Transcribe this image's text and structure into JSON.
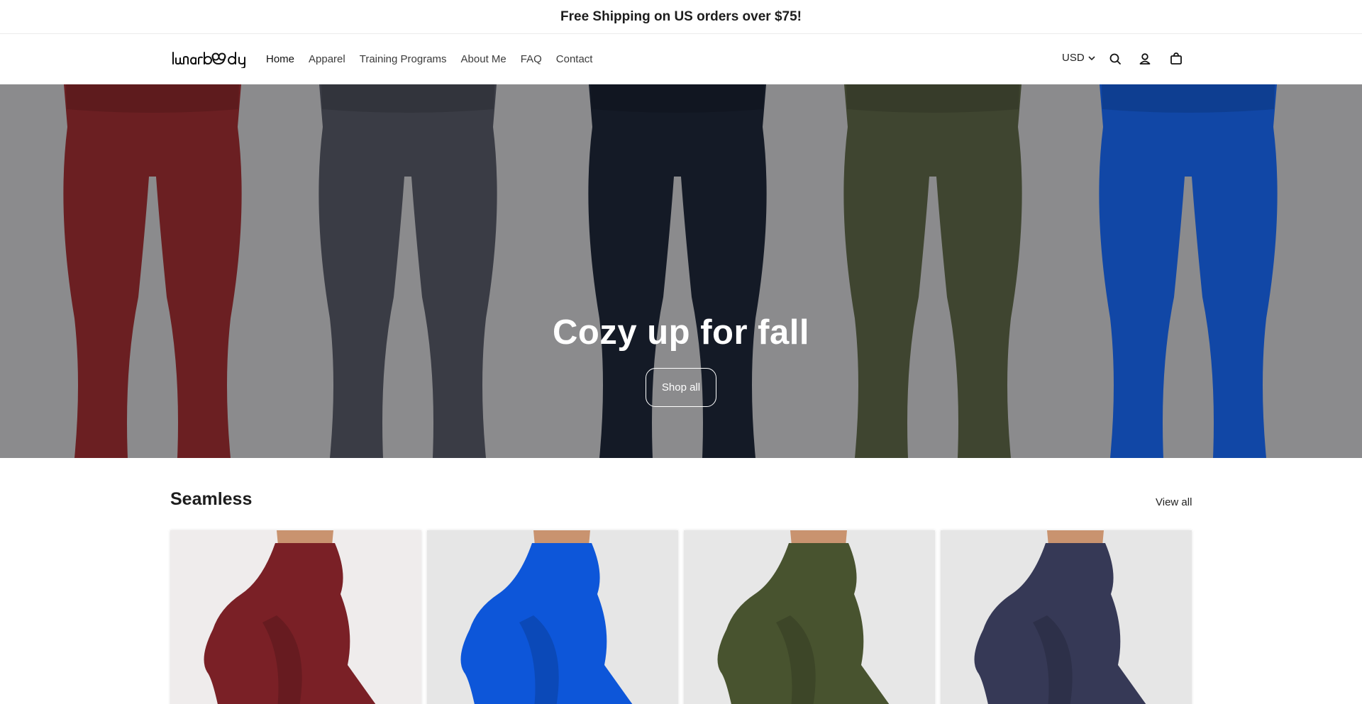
{
  "announcement": {
    "text": "Free Shipping on US orders over $75!"
  },
  "header": {
    "logo_text": "lunarbody",
    "nav": [
      {
        "label": "Home",
        "active": true
      },
      {
        "label": "Apparel"
      },
      {
        "label": "Training Programs"
      },
      {
        "label": "About Me"
      },
      {
        "label": "FAQ"
      },
      {
        "label": "Contact"
      }
    ],
    "currency": "USD",
    "icons": [
      "chevron-down-icon",
      "search-icon",
      "account-icon",
      "cart-icon"
    ]
  },
  "hero": {
    "title": "Cozy up for fall",
    "button_label": "Shop all",
    "legging_colors": [
      "#6b1f22",
      "#3a3c45",
      "#141a26",
      "#3f4530",
      "#1147a6"
    ],
    "background": "#8b8b8d"
  },
  "collection": {
    "title": "Seamless",
    "view_all_label": "View all",
    "products": [
      {
        "color": "#7a2026",
        "background": "#efecec"
      },
      {
        "color": "#0d56d9",
        "background": "#e6e6e6"
      },
      {
        "color": "#48532f",
        "background": "#e7e7e7"
      },
      {
        "color": "#363956",
        "background": "#e6e6e6"
      }
    ]
  }
}
